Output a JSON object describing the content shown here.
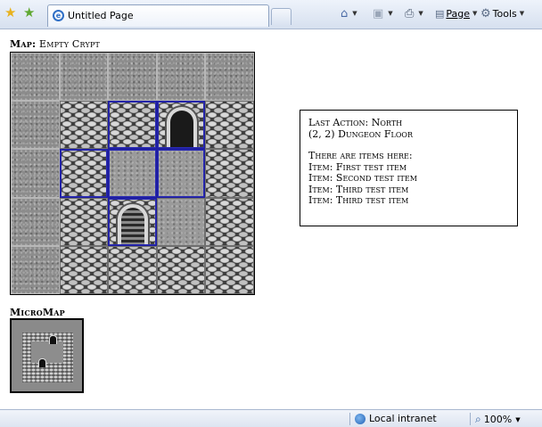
{
  "browser": {
    "tab_title": "Untitled Page",
    "tab_icon": "ie-page-icon",
    "commands": {
      "page_label": "Page",
      "tools_label": "Tools"
    },
    "status": {
      "zone_label": "Local intranet",
      "zoom_label": "100%"
    }
  },
  "map": {
    "label_prefix": "Map:",
    "label_name": "Empty Crypt",
    "grid": [
      [
        "empty",
        "empty",
        "empty",
        "empty",
        "empty"
      ],
      [
        "empty",
        "wall",
        "wall",
        "door",
        "wall"
      ],
      [
        "empty",
        "wall",
        "floor",
        "floor",
        "wall"
      ],
      [
        "empty",
        "wall",
        "stairs",
        "floor",
        "wall"
      ],
      [
        "empty",
        "wall",
        "wall",
        "wall",
        "wall"
      ]
    ],
    "field_of_view": [
      [
        1,
        2
      ],
      [
        1,
        3
      ],
      [
        2,
        1
      ],
      [
        2,
        2
      ],
      [
        2,
        3
      ],
      [
        3,
        2
      ]
    ]
  },
  "info": {
    "last_action": "Last Action: North",
    "location": "(2, 2) Dungeon Floor",
    "items_heading": "There are items here:",
    "items": [
      "Item: First test item",
      "Item: Second test item",
      "Item: Third test item",
      "Item: Third test item"
    ]
  },
  "micromap": {
    "label": "MicroMap"
  }
}
